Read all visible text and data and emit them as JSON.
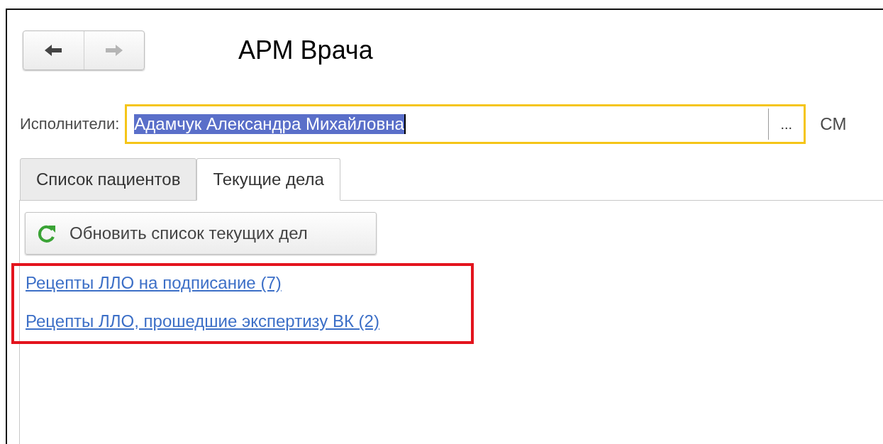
{
  "window": {
    "title": "АРМ Врача"
  },
  "navigation": {
    "back_disabled": false,
    "forward_disabled": true
  },
  "performer": {
    "label": "Исполнители:",
    "value": "Адамчук Александра Михайловна",
    "text_selected": true,
    "focused": true,
    "choose_button": "...",
    "next_label": "СМ"
  },
  "tabs": [
    {
      "label": "Список пациентов",
      "selected": false
    },
    {
      "label": "Текущие дела",
      "selected": true
    }
  ],
  "refresh_button": {
    "label": "Обновить список текущих дел"
  },
  "task_links": {
    "highlighted": true,
    "items": [
      {
        "label": "Рецепты ЛЛО на подписание (7)"
      },
      {
        "label": "Рецепты ЛЛО, прошедшие экспертизу ВК (2)"
      }
    ]
  }
}
